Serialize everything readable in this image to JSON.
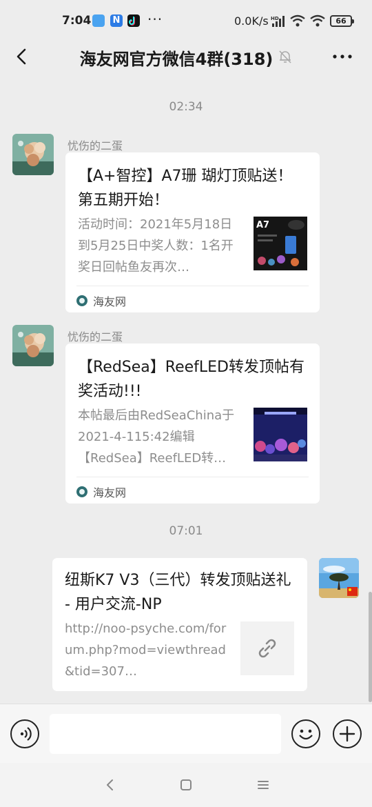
{
  "status_bar": {
    "time": "7:04",
    "more_indicator": "···",
    "net_speed": "0.0K/s",
    "battery": "66",
    "icons": [
      "app-notification-icon",
      "n-app-icon",
      "tiktok-icon",
      "hd-signal-icon",
      "wifi-icon",
      "wifi-icon",
      "battery-icon"
    ]
  },
  "header": {
    "title": "海友网官方微信4群(318)",
    "icons": [
      "back-arrow-icon",
      "mute-bell-icon",
      "more-dots-icon"
    ]
  },
  "messages": [
    {
      "timestamp": "02:34",
      "sender": "忧伤的二蛋",
      "title": "【A+智控】A7珊 瑚灯顶贴送！第五期开始！",
      "description": "活动时间：2021年5月18日到5月25日中奖人数：1名开奖日回帖鱼友再次…",
      "thumb_label": "A7",
      "source": "海友网"
    },
    {
      "sender": "忧伤的二蛋",
      "title": "【RedSea】ReefLED转发顶帖有奖活动!!!",
      "description": "本帖最后由RedSeaChina于2021-4-115:42编辑【RedSea】ReefLED转…",
      "source": "海友网"
    },
    {
      "timestamp": "07:01",
      "sender": "self",
      "title": "纽斯K7 V3（三代）转发顶贴送礼 - 用户交流-NP",
      "description": "http://noo-psyche.com/forum.php?mod=viewthread&tid=307…",
      "thumb_icon": "link-icon"
    }
  ],
  "input_bar": {
    "text_value": "",
    "icons": [
      "voice-icon",
      "emoji-icon",
      "plus-icon"
    ]
  },
  "nav_bar": {
    "icons": [
      "nav-back-icon",
      "nav-home-icon",
      "nav-menu-icon"
    ]
  },
  "colors": {
    "background": "#ededed",
    "card": "#ffffff",
    "muted_text": "#8a8a8a"
  }
}
